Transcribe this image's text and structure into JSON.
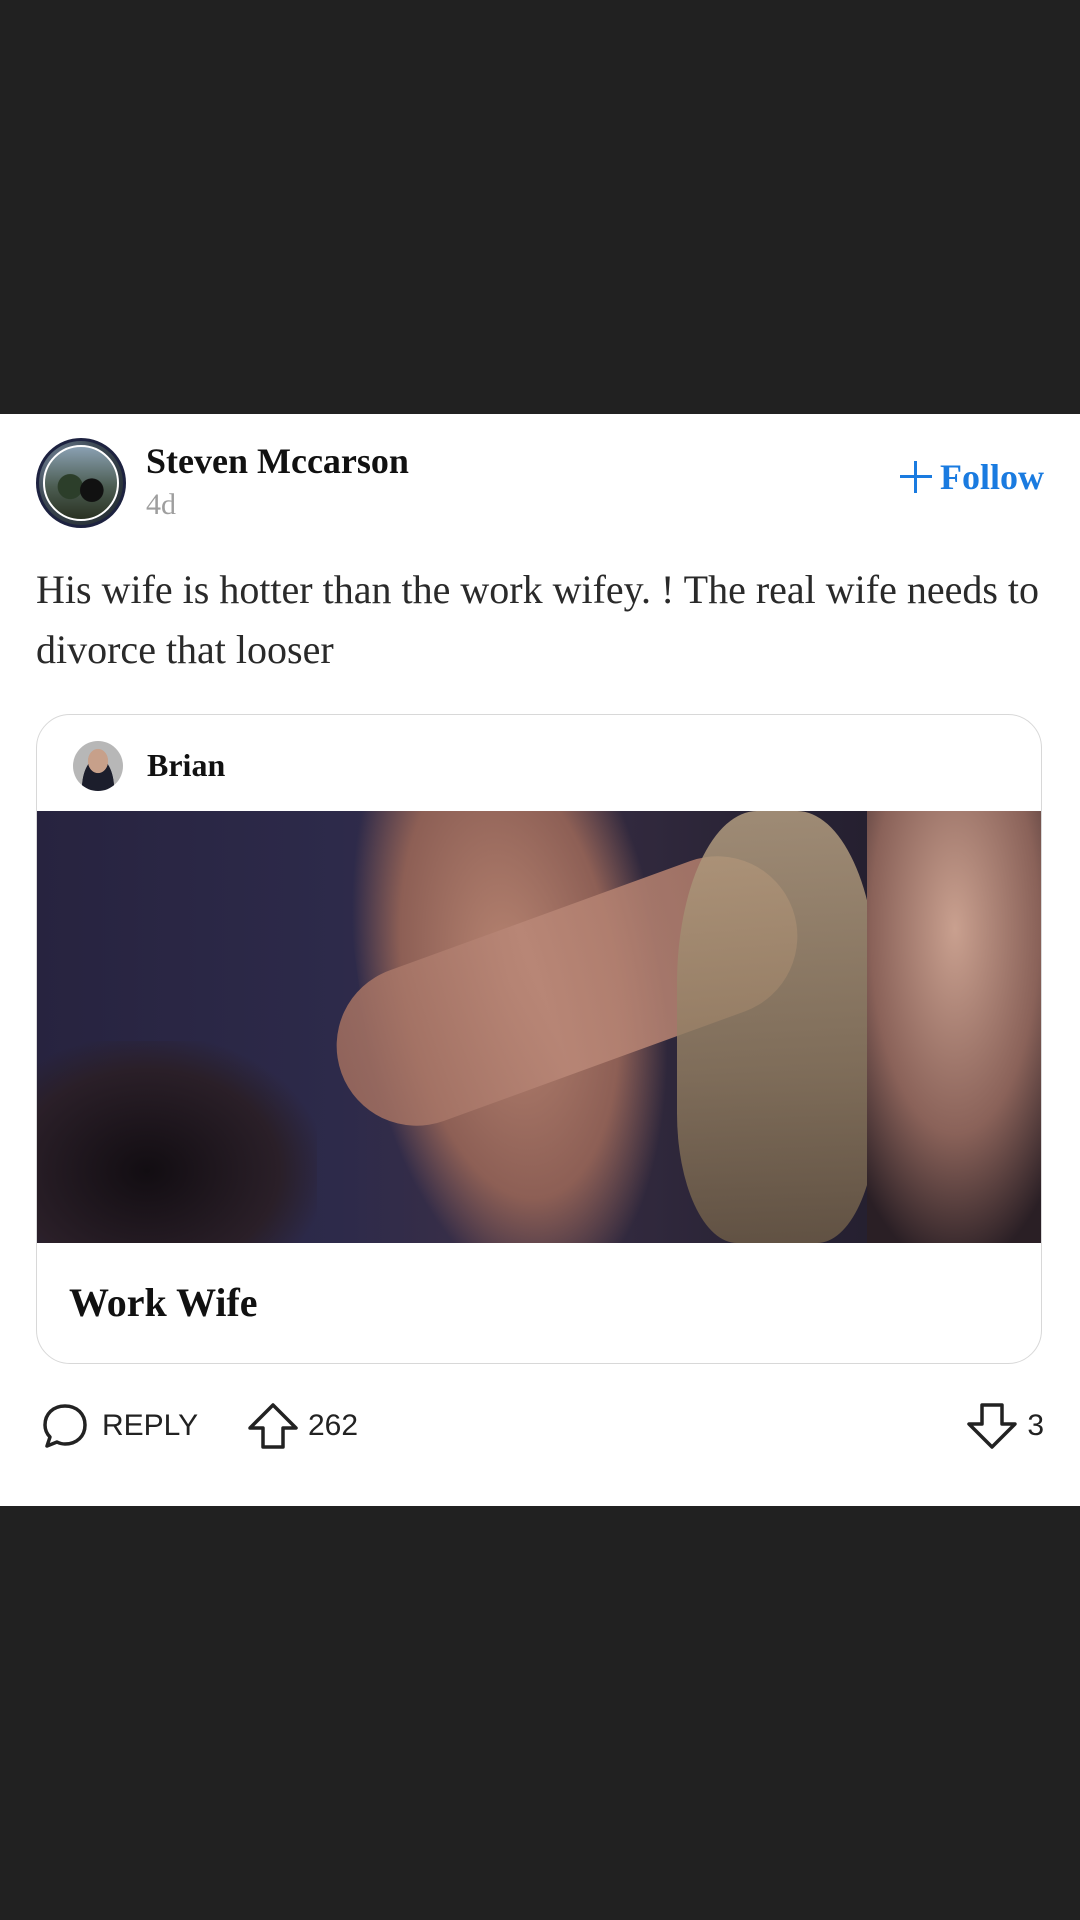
{
  "post": {
    "author_name": "Steven Mccarson",
    "time": "4d",
    "follow_label": "Follow",
    "text": "His wife is hotter than the work wifey. ! The real wife needs to divorce that looser"
  },
  "shared": {
    "author_name": "Brian",
    "title": "Work Wife"
  },
  "actions": {
    "reply_label": "REPLY",
    "upvotes": "262",
    "downvotes": "3"
  },
  "colors": {
    "accent": "#1a7be0",
    "background_dark": "#212121",
    "card": "#ffffff"
  },
  "icons": [
    "plus-icon",
    "comment-bubble-icon",
    "upvote-arrow-icon",
    "downvote-arrow-icon"
  ]
}
